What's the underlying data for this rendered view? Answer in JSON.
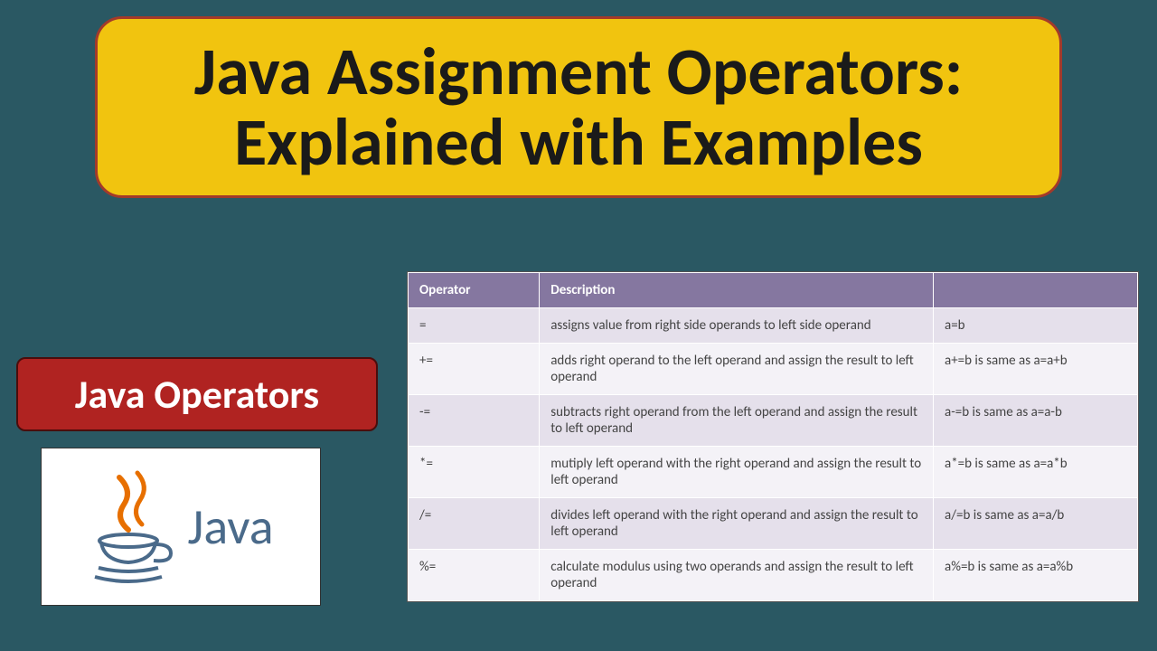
{
  "title": {
    "line1": "Java Assignment Operators:",
    "line2": "Explained with Examples"
  },
  "subtitle": "Java Operators",
  "logo_text": "Java",
  "table": {
    "headers": [
      "Operator",
      "Description",
      ""
    ],
    "rows": [
      {
        "op": "=",
        "desc": "assigns value from right side operands to left side operand",
        "ex": "a=b"
      },
      {
        "op": "+=",
        "desc": "adds right operand to the left operand and assign the result to left operand",
        "ex": "a+=b is same as a=a+b"
      },
      {
        "op": "-=",
        "desc": "subtracts right operand from the left operand and assign the result to left operand",
        "ex": "a-=b is same as a=a-b"
      },
      {
        "op": "*=",
        "desc": "mutiply left operand with the right operand and assign the result to left operand",
        "ex": "a*=b is same as a=a*b"
      },
      {
        "op": "/=",
        "desc": "divides left operand with the right operand and assign the result to left operand",
        "ex": "a/=b is same as a=a/b"
      },
      {
        "op": "%=",
        "desc": "calculate modulus using two operands and assign the result to left operand",
        "ex": "a%=b is same as a=a%b"
      }
    ]
  }
}
